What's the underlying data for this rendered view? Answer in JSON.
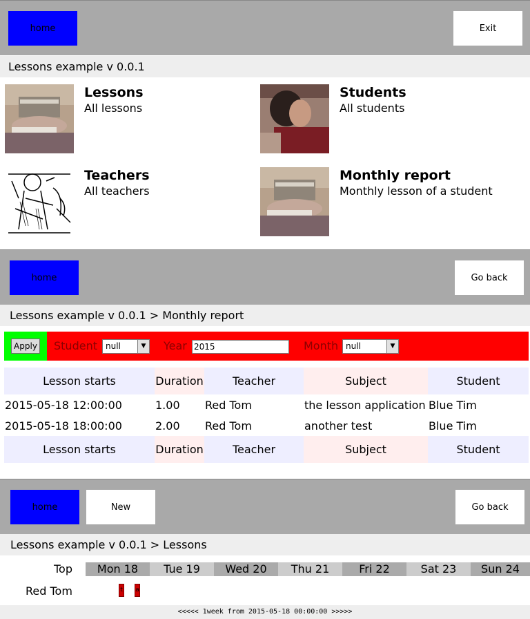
{
  "panel1": {
    "home_label": "home",
    "exit_label": "Exit",
    "breadcrumb": "Lessons example v 0.0.1",
    "tiles": [
      {
        "title": "Lessons",
        "subtitle": "All lessons",
        "image": "reading-woman-photo"
      },
      {
        "title": "Students",
        "subtitle": "All students",
        "image": "student-photo"
      },
      {
        "title": "Teachers",
        "subtitle": "All teachers",
        "image": "teacher-engraving"
      },
      {
        "title": "Monthly report",
        "subtitle": "Monthly lesson of a student",
        "image": "reading-woman-photo"
      }
    ]
  },
  "panel2": {
    "home_label": "home",
    "back_label": "Go back",
    "breadcrumb": "Lessons example v 0.0.1 > Monthly report",
    "filter": {
      "apply_label": "Apply",
      "student_label": "Student",
      "student_value": "null",
      "year_label": "Year",
      "year_value": "2015",
      "month_label": "Month",
      "month_value": "null"
    },
    "table": {
      "columns": [
        "Lesson starts",
        "Duration",
        "Teacher",
        "Subject",
        "Student"
      ],
      "rows": [
        [
          "2015-05-18 12:00:00",
          "1.00",
          "Red Tom",
          "the lesson application",
          "Blue Tim"
        ],
        [
          "2015-05-18 18:00:00",
          "2.00",
          "Red Tom",
          "another test",
          "Blue Tim"
        ]
      ]
    }
  },
  "panel3": {
    "home_label": "home",
    "new_label": "New",
    "back_label": "Go back",
    "breadcrumb": "Lessons example v 0.0.1 > Lessons",
    "calendar": {
      "top_label": "Top",
      "days": [
        "Mon 18",
        "Tue 19",
        "Wed 20",
        "Thu 21",
        "Fri 22",
        "Sat 23",
        "Sun 24"
      ],
      "rows": [
        {
          "label": "Red Tom",
          "events": [
            {
              "day": "Mon 18",
              "text": "t"
            },
            {
              "day": "Mon 18",
              "text": "a"
            }
          ]
        }
      ],
      "nav_text": "<<<<< 1week from 2015-05-18 00:00:00 >>>>>"
    }
  },
  "colors": {
    "toolbar": "#a9a9a9",
    "home_button": "#0000ff",
    "filter_bar": "#ff0000",
    "apply_area": "#00ff00",
    "lesson_bar": "#cc0000"
  }
}
